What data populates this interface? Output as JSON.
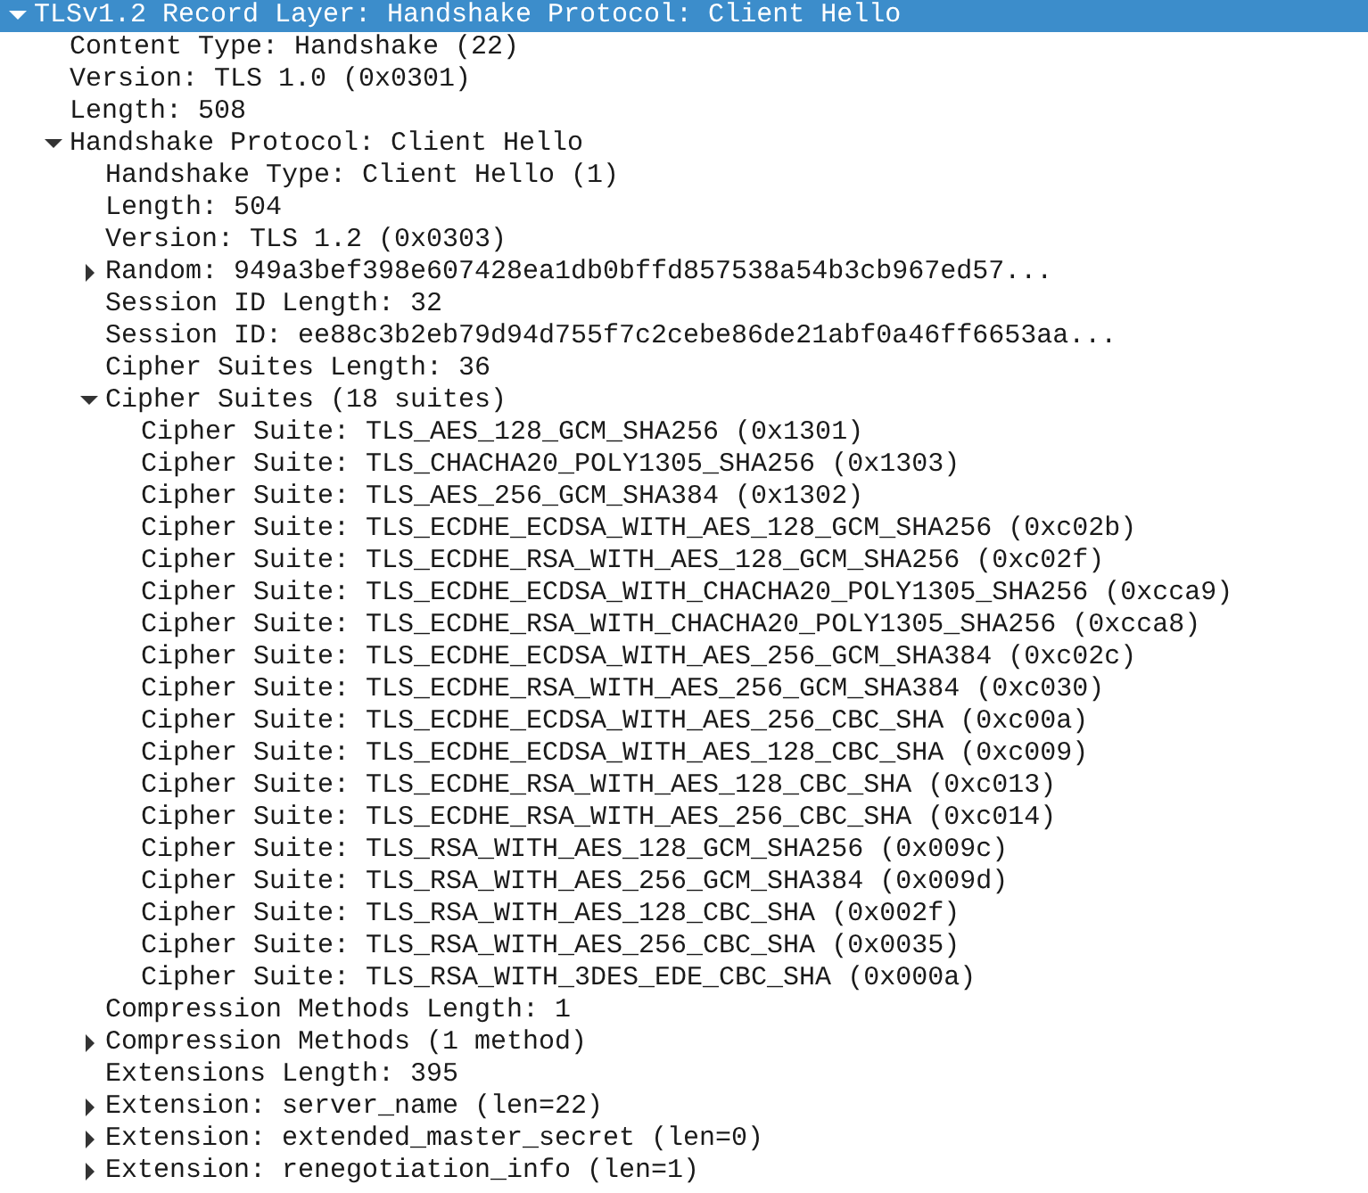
{
  "tree": [
    {
      "label": "TLSv1.2 Record Layer: Handshake Protocol: Client Hello",
      "expanded": true,
      "selected": true,
      "children": [
        {
          "label": "Content Type: Handshake (22)",
          "selected": false
        },
        {
          "label": "Version: TLS 1.0 (0x0301)",
          "selected": false
        },
        {
          "label": "Length: 508",
          "selected": false
        },
        {
          "label": "Handshake Protocol: Client Hello",
          "expanded": true,
          "selected": false,
          "children": [
            {
              "label": "Handshake Type: Client Hello (1)",
              "selected": false
            },
            {
              "label": "Length: 504",
              "selected": false
            },
            {
              "label": "Version: TLS 1.2 (0x0303)",
              "selected": false
            },
            {
              "label": "Random: 949a3bef398e607428ea1db0bffd857538a54b3cb967ed57...",
              "expanded": false,
              "selected": false
            },
            {
              "label": "Session ID Length: 32",
              "selected": false
            },
            {
              "label": "Session ID: ee88c3b2eb79d94d755f7c2cebe86de21abf0a46ff6653aa...",
              "selected": false
            },
            {
              "label": "Cipher Suites Length: 36",
              "selected": false
            },
            {
              "label": "Cipher Suites (18 suites)",
              "expanded": true,
              "selected": false,
              "children": [
                {
                  "label": "Cipher Suite: TLS_AES_128_GCM_SHA256 (0x1301)",
                  "selected": false
                },
                {
                  "label": "Cipher Suite: TLS_CHACHA20_POLY1305_SHA256 (0x1303)",
                  "selected": false
                },
                {
                  "label": "Cipher Suite: TLS_AES_256_GCM_SHA384 (0x1302)",
                  "selected": false
                },
                {
                  "label": "Cipher Suite: TLS_ECDHE_ECDSA_WITH_AES_128_GCM_SHA256 (0xc02b)",
                  "selected": false
                },
                {
                  "label": "Cipher Suite: TLS_ECDHE_RSA_WITH_AES_128_GCM_SHA256 (0xc02f)",
                  "selected": false
                },
                {
                  "label": "Cipher Suite: TLS_ECDHE_ECDSA_WITH_CHACHA20_POLY1305_SHA256 (0xcca9)",
                  "selected": false
                },
                {
                  "label": "Cipher Suite: TLS_ECDHE_RSA_WITH_CHACHA20_POLY1305_SHA256 (0xcca8)",
                  "selected": false
                },
                {
                  "label": "Cipher Suite: TLS_ECDHE_ECDSA_WITH_AES_256_GCM_SHA384 (0xc02c)",
                  "selected": false
                },
                {
                  "label": "Cipher Suite: TLS_ECDHE_RSA_WITH_AES_256_GCM_SHA384 (0xc030)",
                  "selected": false
                },
                {
                  "label": "Cipher Suite: TLS_ECDHE_ECDSA_WITH_AES_256_CBC_SHA (0xc00a)",
                  "selected": false
                },
                {
                  "label": "Cipher Suite: TLS_ECDHE_ECDSA_WITH_AES_128_CBC_SHA (0xc009)",
                  "selected": false
                },
                {
                  "label": "Cipher Suite: TLS_ECDHE_RSA_WITH_AES_128_CBC_SHA (0xc013)",
                  "selected": false
                },
                {
                  "label": "Cipher Suite: TLS_ECDHE_RSA_WITH_AES_256_CBC_SHA (0xc014)",
                  "selected": false
                },
                {
                  "label": "Cipher Suite: TLS_RSA_WITH_AES_128_GCM_SHA256 (0x009c)",
                  "selected": false
                },
                {
                  "label": "Cipher Suite: TLS_RSA_WITH_AES_256_GCM_SHA384 (0x009d)",
                  "selected": false
                },
                {
                  "label": "Cipher Suite: TLS_RSA_WITH_AES_128_CBC_SHA (0x002f)",
                  "selected": false
                },
                {
                  "label": "Cipher Suite: TLS_RSA_WITH_AES_256_CBC_SHA (0x0035)",
                  "selected": false
                },
                {
                  "label": "Cipher Suite: TLS_RSA_WITH_3DES_EDE_CBC_SHA (0x000a)",
                  "selected": false
                }
              ]
            },
            {
              "label": "Compression Methods Length: 1",
              "selected": false
            },
            {
              "label": "Compression Methods (1 method)",
              "expanded": false,
              "selected": false
            },
            {
              "label": "Extensions Length: 395",
              "selected": false
            },
            {
              "label": "Extension: server_name (len=22)",
              "expanded": false,
              "selected": false
            },
            {
              "label": "Extension: extended_master_secret (len=0)",
              "expanded": false,
              "selected": false
            },
            {
              "label": "Extension: renegotiation_info (len=1)",
              "expanded": false,
              "selected": false
            }
          ]
        }
      ]
    }
  ]
}
